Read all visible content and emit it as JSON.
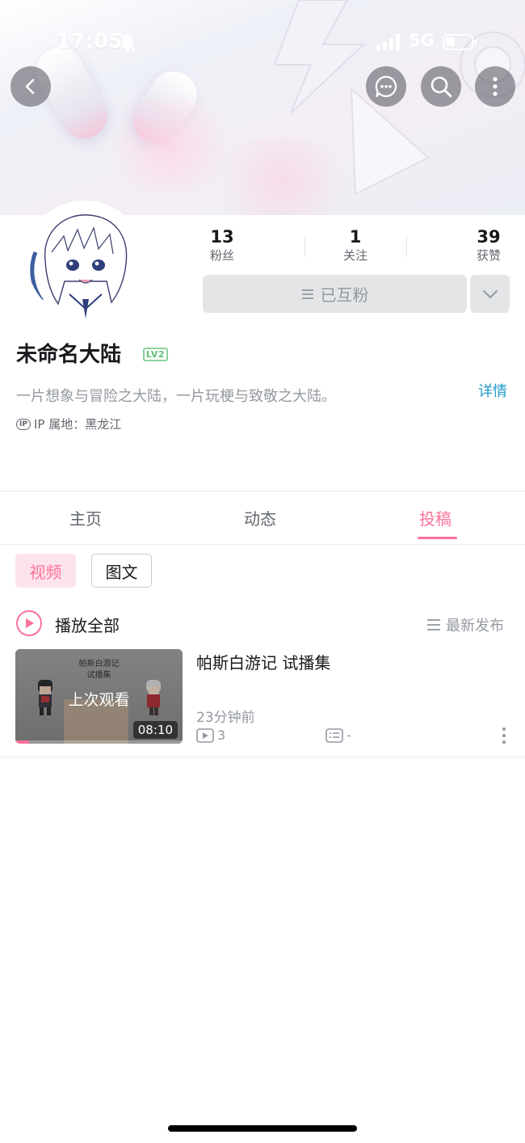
{
  "status_bar": {
    "time": "17:05",
    "network": "5G",
    "battery_level": 0.35,
    "icons": [
      "bell-off-icon",
      "signal-icon",
      "battery-icon"
    ]
  },
  "top_actions": {
    "icons": [
      "back-icon",
      "message-icon",
      "search-icon",
      "more-vertical-icon"
    ]
  },
  "profile": {
    "stats": [
      {
        "value": "13",
        "label": "粉丝"
      },
      {
        "value": "1",
        "label": "关注"
      },
      {
        "value": "39",
        "label": "获赞"
      }
    ],
    "follow_button_label": "已互粉",
    "name": "未命名大陆",
    "level_badge": "LV2",
    "bio": "一片想象与冒险之大陆，一片玩梗与致敬之大陆。",
    "detail_link": "详情",
    "ip_badge": "IP",
    "ip_location": "IP 属地：黑龙江"
  },
  "tabs": [
    {
      "label": "主页",
      "active": false
    },
    {
      "label": "动态",
      "active": false
    },
    {
      "label": "投稿",
      "active": true
    }
  ],
  "filter_chips": [
    {
      "label": "视频",
      "active": true
    },
    {
      "label": "图文",
      "active": false
    }
  ],
  "play_all_label": "播放全部",
  "sort_label": "最新发布",
  "videos": [
    {
      "title": "帕斯白游记 试播集",
      "thumbnail_title": "帕斯白游记",
      "thumbnail_subtitle": "试播集",
      "watched_label": "上次观看",
      "duration": "08:10",
      "watch_progress": 0.08,
      "published": "23分钟前",
      "play_count": "3",
      "comment_count": "-"
    }
  ],
  "colors": {
    "accent_pink": "#fb7299",
    "link_blue": "#1f9bc8",
    "level_green": "#5fbf74",
    "text_gray": "#9499a0"
  }
}
